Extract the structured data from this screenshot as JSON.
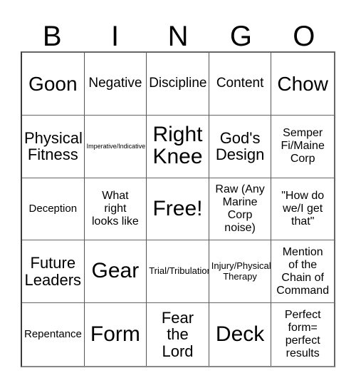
{
  "card": {
    "header_letters": [
      "B",
      "I",
      "N",
      "G",
      "O"
    ],
    "columns": 5,
    "rows": 5,
    "background_color": "#ffffff",
    "text_color": "#000000",
    "border_color": "#555555",
    "free_space_label": "Free!",
    "free_space_position": "center",
    "cells": [
      {
        "text": "Goon",
        "size": "lg"
      },
      {
        "text": "Negative",
        "size": "sm"
      },
      {
        "text": "Discipline",
        "size": "sm"
      },
      {
        "text": "Content",
        "size": "sm"
      },
      {
        "text": "Chow",
        "size": "lg"
      },
      {
        "text": "Physical\nFitness",
        "size": "md"
      },
      {
        "text": "Imperative/Indicative",
        "size": "micro"
      },
      {
        "text": "Right\nKnee",
        "size": "xl"
      },
      {
        "text": "God's\nDesign",
        "size": "md"
      },
      {
        "text": "Semper\nFi/Maine\nCorp",
        "size": "xs"
      },
      {
        "text": "Deception",
        "size": "xxs"
      },
      {
        "text": "What\nright\nlooks like",
        "size": "xs"
      },
      {
        "text": "Free!",
        "size": "xl"
      },
      {
        "text": "Raw (Any\nMarine\nCorp\nnoise)",
        "size": "xs"
      },
      {
        "text": "\"How do\nwe/I get\nthat\"",
        "size": "xs"
      },
      {
        "text": "Future\nLeaders",
        "size": "md"
      },
      {
        "text": "Gear",
        "size": "xl"
      },
      {
        "text": "Trial/Tribulation",
        "size": "tiny"
      },
      {
        "text": "Injury/Physical\nTherapy",
        "size": "tiny"
      },
      {
        "text": "Mention\nof the\nChain of\nCommand",
        "size": "xs"
      },
      {
        "text": "Repentance",
        "size": "xxs"
      },
      {
        "text": "Form",
        "size": "xl"
      },
      {
        "text": "Fear\nthe\nLord",
        "size": "md"
      },
      {
        "text": "Deck",
        "size": "xl"
      },
      {
        "text": "Perfect\nform=\nperfect\nresults",
        "size": "xs"
      }
    ]
  }
}
